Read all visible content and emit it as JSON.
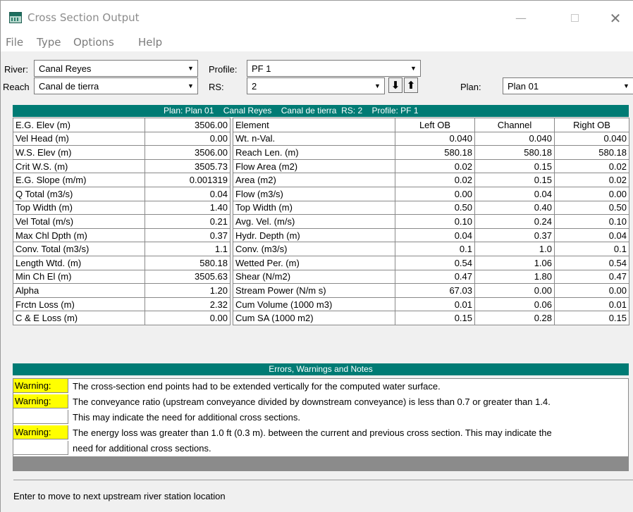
{
  "window": {
    "title": "Cross Section Output"
  },
  "menu": [
    "File",
    "Type",
    "Options",
    "Help"
  ],
  "controls": {
    "river_label": "River:",
    "river_value": "Canal Reyes",
    "profile_label": "Profile:",
    "profile_value": "PF 1",
    "reach_label": "Reach",
    "reach_value": "Canal de tierra",
    "rs_label": "RS:",
    "rs_value": "2",
    "plan_label": "Plan:",
    "plan_value": "Plan 01",
    "down_arrow": "⬇",
    "up_arrow": "⬆"
  },
  "summary_bar": "Plan: Plan 01    Canal Reyes    Canal de tierra  RS: 2    Profile: PF 1",
  "left_table": [
    [
      "E.G. Elev (m)",
      "3506.00"
    ],
    [
      "Vel Head (m)",
      "0.00"
    ],
    [
      "W.S. Elev (m)",
      "3506.00"
    ],
    [
      "Crit W.S. (m)",
      "3505.73"
    ],
    [
      "E.G. Slope (m/m)",
      "0.001319"
    ],
    [
      "Q Total (m3/s)",
      "0.04"
    ],
    [
      "Top Width (m)",
      "1.40"
    ],
    [
      "Vel Total (m/s)",
      "0.21"
    ],
    [
      "Max Chl Dpth (m)",
      "0.37"
    ],
    [
      "Conv. Total (m3/s)",
      "1.1"
    ],
    [
      "Length Wtd. (m)",
      "580.18"
    ],
    [
      "Min Ch El (m)",
      "3505.63"
    ],
    [
      "Alpha",
      "1.20"
    ],
    [
      "Frctn Loss (m)",
      "2.32"
    ],
    [
      "C & E Loss (m)",
      "0.00"
    ]
  ],
  "right_table": {
    "headers": [
      "Element",
      "Left OB",
      "Channel",
      "Right OB"
    ],
    "rows": [
      [
        "Wt. n-Val.",
        "0.040",
        "0.040",
        "0.040"
      ],
      [
        "Reach Len. (m)",
        "580.18",
        "580.18",
        "580.18"
      ],
      [
        "Flow Area (m2)",
        "0.02",
        "0.15",
        "0.02"
      ],
      [
        "Area (m2)",
        "0.02",
        "0.15",
        "0.02"
      ],
      [
        "Flow (m3/s)",
        "0.00",
        "0.04",
        "0.00"
      ],
      [
        "Top Width (m)",
        "0.50",
        "0.40",
        "0.50"
      ],
      [
        "Avg. Vel. (m/s)",
        "0.10",
        "0.24",
        "0.10"
      ],
      [
        "Hydr. Depth (m)",
        "0.04",
        "0.37",
        "0.04"
      ],
      [
        "Conv. (m3/s)",
        "0.1",
        "1.0",
        "0.1"
      ],
      [
        "Wetted Per. (m)",
        "0.54",
        "1.06",
        "0.54"
      ],
      [
        "Shear (N/m2)",
        "0.47",
        "1.80",
        "0.47"
      ],
      [
        "Stream Power (N/m s)",
        "67.03",
        "0.00",
        "0.00"
      ],
      [
        "Cum Volume (1000 m3)",
        "0.01",
        "0.06",
        "0.01"
      ],
      [
        "Cum SA (1000 m2)",
        "0.15",
        "0.28",
        "0.15"
      ]
    ]
  },
  "notes_header": "Errors, Warnings and Notes",
  "notes": [
    {
      "tag": "Warning:",
      "text": "The cross-section end points had to be extended vertically for the computed water surface."
    },
    {
      "tag": "Warning:",
      "text": "The conveyance ratio (upstream conveyance divided by downstream conveyance) is less than 0.7 or greater than 1.4."
    },
    {
      "tag": "",
      "text": "This may indicate the need for additional cross sections."
    },
    {
      "tag": "Warning:",
      "text": "The energy loss was greater than 1.0 ft (0.3 m). between the current and previous cross section.  This may indicate the"
    },
    {
      "tag": "",
      "text": "need for additional cross sections."
    }
  ],
  "status_text": "Enter to move to next upstream river station location",
  "colors": {
    "teal": "#007b74",
    "warning": "#ffff00"
  },
  "icons": [
    "app-icon",
    "minimize-icon",
    "maximize-icon",
    "close-icon",
    "dropdown-arrow-icon",
    "down-arrow-icon",
    "up-arrow-icon"
  ]
}
